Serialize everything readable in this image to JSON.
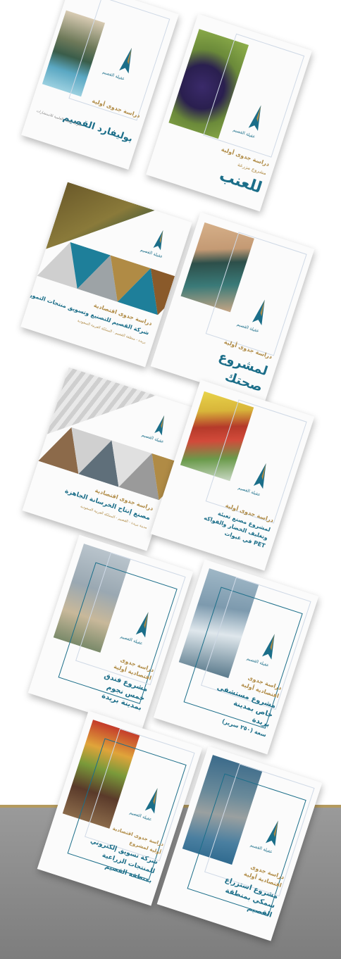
{
  "covers": [
    {
      "title": "بوليفارد القصيم",
      "subtitle": "دراسة جدوى أولية",
      "company": "شركة عقيلة العلمية للاستشارات",
      "logo_name": "عقيلة القصيم"
    },
    {
      "title": "للعنب",
      "subtitle": "دراسة جدوى أولية",
      "company": "مشروع مزرعة",
      "logo_name": "عقيلة القصيم"
    },
    {
      "title": "شركة القصيم للتصنيع وتسويق منتجات التمور",
      "subtitle": "دراسة جدوى اقتصادية",
      "location": "بريدة - منطقة القصيم - المملكة العربية السعودية",
      "logo_name": "عقيلة القصيم"
    },
    {
      "title_line1": "لمشروع",
      "title_line2": "صحتك",
      "subtitle": "دراسة جدوى أولية",
      "logo_name": "عقيلة القصيم"
    },
    {
      "title": "مصنع إنتاج الخرسانة الجاهزة",
      "subtitle": "دراسة جدوى اقتصادية",
      "location": "مدينة بريدة - القصيم - المملكة العربية السعودية",
      "logo_name": "عقيلة القصيم"
    },
    {
      "line1": "دراسة جدوى أولية",
      "line2": "لمشروع مصنع تعبئة",
      "line3": "وتغليف الخضار والفواكه",
      "line4": "PET في عبوات",
      "logo_name": "عقيلة القصيم"
    },
    {
      "sub1": "دراسة جدوى",
      "sub2": "اقتصادية أولية",
      "t1": "مشروع فندق",
      "t2": "خمس نجوم",
      "t3": "بمدينة بريدة",
      "logo_name": "عقيلة القصيم"
    },
    {
      "sub1": "دراسة جدوى",
      "sub2": "اقتصادية أولية",
      "t1": "مشروع مستشفى",
      "t2": "خاص بمدينة",
      "t3": "بريدة",
      "t4": "سعة (٢٥٠ سرير)",
      "logo_name": "عقيلة القصيم"
    },
    {
      "sub1": "دراسة جدوى اقتصادية",
      "sub2": "أولية لمشروع",
      "t1": "شركة تسويق إلكتروني",
      "t2": "للمنتجات الزراعية",
      "t3": "بمنطقة القصيم",
      "logo_name": "عقيلة القصيم"
    },
    {
      "sub1": "دراسة جدوى",
      "sub2": "اقتصادية أولية",
      "t1": "مشروع استزراع",
      "t2": "سمكي بمنطقة",
      "t3": "القصيم",
      "logo_name": "عقيلة القصيم"
    }
  ],
  "colors": {
    "teal": "#1b6e89",
    "gold": "#b08b45",
    "grey_band": "#8a8a8a"
  }
}
